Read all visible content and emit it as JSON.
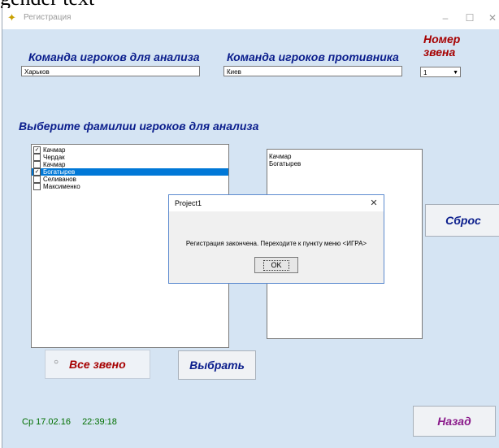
{
  "top_fragment": "gender text",
  "window": {
    "title": "Регистрация",
    "minimize": "–",
    "maximize": "☐",
    "close": "✕"
  },
  "labels": {
    "team_analysis": "Команда игроков для анализа",
    "team_opponent": "Команда игроков противника",
    "unit_number": "Номер звена",
    "choose_players": "Выберите фамилии игроков для анализа"
  },
  "fields": {
    "team_analysis_value": "Харьков",
    "team_opponent_value": "Киев",
    "unit_number_value": "1"
  },
  "players_list": [
    {
      "name": "Качмар",
      "checked": true,
      "selected": false
    },
    {
      "name": "Чердак",
      "checked": false,
      "selected": false
    },
    {
      "name": "Качмар",
      "checked": false,
      "selected": false
    },
    {
      "name": "Богатырев",
      "checked": true,
      "selected": true
    },
    {
      "name": "Селиванов",
      "checked": false,
      "selected": false
    },
    {
      "name": "Максименко",
      "checked": false,
      "selected": false
    }
  ],
  "selected_players": [
    "Качмар",
    "Богатырев"
  ],
  "buttons": {
    "reset": "Сброс",
    "choose": "Выбрать",
    "back": "Назад"
  },
  "radio": {
    "whole_unit": "Все звено"
  },
  "status": {
    "date": "Ср 17.02.16",
    "time": "22:39:18"
  },
  "dialog": {
    "title": "Project1",
    "message": "Регистрация закончена. Переходите к пункту меню <ИГРА>",
    "ok": "OK",
    "close": "✕"
  },
  "colors": {
    "window_bg": "#d5e4f3",
    "label_blue": "#0a1d8c",
    "label_red": "#a60000",
    "label_purple": "#8a1a8a",
    "status_green": "#006f00",
    "selection": "#0078d7"
  }
}
